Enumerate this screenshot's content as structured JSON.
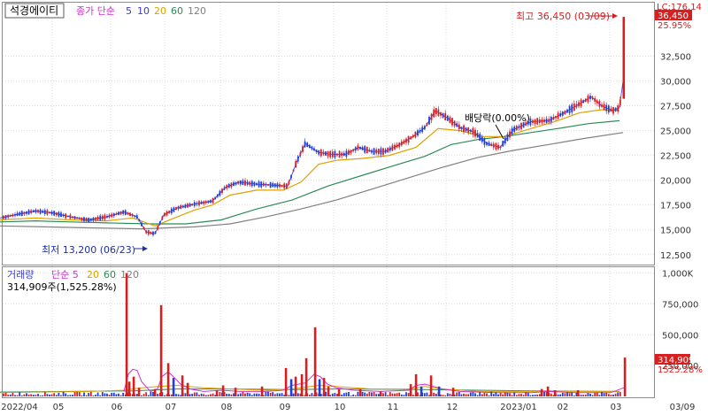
{
  "chart_data": [
    {
      "type": "candlestick",
      "title": "석경에이티",
      "legend": [
        {
          "label": "종가 단순",
          "color": "#cc33cc"
        },
        {
          "label": "5",
          "color": "#3a3ad8"
        },
        {
          "label": "10",
          "color": "#3a3ad8"
        },
        {
          "label": "20",
          "color": "#e0a000"
        },
        {
          "label": "60",
          "color": "#2e8b57"
        },
        {
          "label": "120",
          "color": "#808080"
        }
      ],
      "ylim": [
        11500,
        37800
      ],
      "yticks": [
        "12,500",
        "15,000",
        "17,500",
        "20,000",
        "22,500",
        "25,000",
        "27,500",
        "30,000",
        "32,500"
      ],
      "right_badges": {
        "lc": "LC:176.14",
        "last": "36,450",
        "pct": "25.95%"
      },
      "annotations": {
        "high": "최고 36,450 (03/09)",
        "low": "최저 13,200 (06/23)",
        "dividend": "배당락(0.00%)"
      },
      "series": [
        {
          "name": "5",
          "color": "#3a3ad8",
          "points": [
            [
              0,
              16200
            ],
            [
              22,
              16600
            ],
            [
              40,
              16900
            ],
            [
              60,
              16700
            ],
            [
              80,
              16300
            ],
            [
              100,
              16000
            ],
            [
              120,
              16300
            ],
            [
              140,
              16800
            ],
            [
              155,
              16300
            ],
            [
              165,
              14800
            ],
            [
              175,
              14600
            ],
            [
              185,
              16500
            ],
            [
              200,
              17200
            ],
            [
              220,
              17600
            ],
            [
              240,
              17900
            ],
            [
              255,
              19300
            ],
            [
              270,
              19800
            ],
            [
              290,
              19600
            ],
            [
              310,
              19500
            ],
            [
              325,
              19400
            ],
            [
              335,
              21800
            ],
            [
              345,
              23700
            ],
            [
              360,
              22800
            ],
            [
              375,
              22600
            ],
            [
              390,
              22600
            ],
            [
              405,
              23300
            ],
            [
              420,
              22900
            ],
            [
              435,
              22900
            ],
            [
              450,
              23500
            ],
            [
              465,
              24300
            ],
            [
              480,
              25300
            ],
            [
              492,
              27000
            ],
            [
              505,
              26300
            ],
            [
              520,
              25300
            ],
            [
              535,
              24900
            ],
            [
              550,
              23700
            ],
            [
              565,
              23300
            ],
            [
              580,
              25100
            ],
            [
              600,
              25900
            ],
            [
              620,
              26000
            ],
            [
              640,
              26900
            ],
            [
              655,
              27700
            ],
            [
              668,
              28400
            ],
            [
              680,
              27500
            ],
            [
              692,
              27000
            ],
            [
              700,
              27300
            ],
            [
              704,
              30000
            ]
          ]
        },
        {
          "name": "20",
          "color": "#e0a000",
          "points": [
            [
              0,
              16000
            ],
            [
              40,
              16200
            ],
            [
              80,
              16000
            ],
            [
              120,
              15900
            ],
            [
              150,
              16200
            ],
            [
              175,
              15400
            ],
            [
              200,
              16300
            ],
            [
              220,
              17000
            ],
            [
              240,
              17500
            ],
            [
              260,
              18500
            ],
            [
              290,
              19000
            ],
            [
              320,
              19000
            ],
            [
              340,
              19800
            ],
            [
              360,
              21600
            ],
            [
              380,
              22000
            ],
            [
              410,
              22200
            ],
            [
              440,
              22500
            ],
            [
              470,
              23300
            ],
            [
              495,
              25200
            ],
            [
              520,
              25000
            ],
            [
              545,
              24400
            ],
            [
              570,
              24400
            ],
            [
              600,
              25200
            ],
            [
              630,
              26000
            ],
            [
              655,
              26800
            ],
            [
              680,
              27100
            ],
            [
              700,
              27000
            ]
          ]
        },
        {
          "name": "60",
          "color": "#2e8b57",
          "points": [
            [
              0,
              15800
            ],
            [
              40,
              15900
            ],
            [
              80,
              15800
            ],
            [
              120,
              15700
            ],
            [
              170,
              15600
            ],
            [
              210,
              15600
            ],
            [
              250,
              16000
            ],
            [
              290,
              17100
            ],
            [
              330,
              18000
            ],
            [
              370,
              19400
            ],
            [
              410,
              20500
            ],
            [
              450,
              21600
            ],
            [
              480,
              22400
            ],
            [
              510,
              23600
            ],
            [
              540,
              24100
            ],
            [
              570,
              24400
            ],
            [
              600,
              24800
            ],
            [
              630,
              25200
            ],
            [
              665,
              25700
            ],
            [
              700,
              26000
            ]
          ]
        },
        {
          "name": "120",
          "color": "#808080",
          "points": [
            [
              0,
              15400
            ],
            [
              50,
              15300
            ],
            [
              100,
              15200
            ],
            [
              160,
              15100
            ],
            [
              220,
              15300
            ],
            [
              260,
              15600
            ],
            [
              300,
              16300
            ],
            [
              340,
              17100
            ],
            [
              380,
              18000
            ],
            [
              420,
              19100
            ],
            [
              460,
              20200
            ],
            [
              500,
              21300
            ],
            [
              540,
              22300
            ],
            [
              580,
              23000
            ],
            [
              620,
              23600
            ],
            [
              660,
              24200
            ],
            [
              704,
              24800
            ]
          ]
        }
      ]
    },
    {
      "type": "bar",
      "title": "거래량",
      "legend": [
        {
          "label": "거래량",
          "color": "#3a3ad8"
        },
        {
          "label": "단순 5",
          "color": "#cc33cc"
        },
        {
          "label": "20",
          "color": "#e0a000"
        },
        {
          "label": "60",
          "color": "#2e8b57"
        },
        {
          "label": "120",
          "color": "#808080"
        }
      ],
      "subtitle": "314,909주(1,525.28%)",
      "ylim": [
        0,
        1040000
      ],
      "yticks": [
        "1,000K",
        "750,000",
        "500,000",
        "250,000"
      ],
      "right_badges": {
        "last": "314,909",
        "pct": "1525.28%"
      },
      "spikes": [
        [
          143,
          1000000,
          "up"
        ],
        [
          146,
          120000,
          "up"
        ],
        [
          151,
          160000,
          "up"
        ],
        [
          157,
          70000,
          "up"
        ],
        [
          175,
          60000,
          "up"
        ],
        [
          182,
          740000,
          "up"
        ],
        [
          190,
          270000,
          "up"
        ],
        [
          196,
          150000,
          "down"
        ],
        [
          206,
          170000,
          "up"
        ],
        [
          212,
          110000,
          "up"
        ],
        [
          245,
          50000,
          "up"
        ],
        [
          252,
          90000,
          "up"
        ],
        [
          266,
          70000,
          "up"
        ],
        [
          296,
          80000,
          "up"
        ],
        [
          323,
          230000,
          "up"
        ],
        [
          329,
          140000,
          "down"
        ],
        [
          334,
          160000,
          "up"
        ],
        [
          341,
          180000,
          "up"
        ],
        [
          346,
          310000,
          "up"
        ],
        [
          356,
          560000,
          "up"
        ],
        [
          361,
          140000,
          "down"
        ],
        [
          366,
          150000,
          "up"
        ],
        [
          371,
          80000,
          "up"
        ],
        [
          383,
          60000,
          "up"
        ],
        [
          407,
          60000,
          "up"
        ],
        [
          430,
          40000,
          "up"
        ],
        [
          464,
          100000,
          "up"
        ],
        [
          470,
          180000,
          "up"
        ],
        [
          476,
          80000,
          "down"
        ],
        [
          487,
          170000,
          "up"
        ],
        [
          496,
          80000,
          "down"
        ],
        [
          512,
          70000,
          "up"
        ],
        [
          612,
          60000,
          "up"
        ],
        [
          619,
          80000,
          "up"
        ],
        [
          627,
          50000,
          "up"
        ],
        [
          653,
          50000,
          "up"
        ],
        [
          706,
          314909,
          "up"
        ]
      ],
      "avg5": [
        [
          140,
          40000
        ],
        [
          145,
          180000
        ],
        [
          150,
          220000
        ],
        [
          155,
          210000
        ],
        [
          160,
          120000
        ],
        [
          170,
          40000
        ],
        [
          178,
          60000
        ],
        [
          183,
          160000
        ],
        [
          190,
          200000
        ],
        [
          196,
          160000
        ],
        [
          204,
          100000
        ],
        [
          215,
          60000
        ],
        [
          230,
          40000
        ],
        [
          250,
          50000
        ],
        [
          270,
          40000
        ],
        [
          300,
          40000
        ],
        [
          320,
          50000
        ],
        [
          330,
          90000
        ],
        [
          345,
          110000
        ],
        [
          355,
          180000
        ],
        [
          362,
          160000
        ],
        [
          370,
          100000
        ],
        [
          380,
          70000
        ],
        [
          400,
          50000
        ],
        [
          430,
          40000
        ],
        [
          462,
          50000
        ],
        [
          470,
          90000
        ],
        [
          480,
          100000
        ],
        [
          490,
          80000
        ],
        [
          500,
          60000
        ],
        [
          520,
          40000
        ],
        [
          560,
          30000
        ],
        [
          600,
          30000
        ],
        [
          620,
          40000
        ],
        [
          650,
          30000
        ],
        [
          690,
          30000
        ],
        [
          705,
          70000
        ]
      ],
      "avg20": [
        [
          0,
          30000
        ],
        [
          100,
          40000
        ],
        [
          140,
          50000
        ],
        [
          160,
          70000
        ],
        [
          180,
          80000
        ],
        [
          200,
          90000
        ],
        [
          230,
          70000
        ],
        [
          260,
          60000
        ],
        [
          300,
          50000
        ],
        [
          330,
          60000
        ],
        [
          360,
          90000
        ],
        [
          380,
          80000
        ],
        [
          420,
          60000
        ],
        [
          460,
          60000
        ],
        [
          480,
          80000
        ],
        [
          500,
          60000
        ],
        [
          540,
          40000
        ],
        [
          600,
          40000
        ],
        [
          650,
          40000
        ],
        [
          700,
          40000
        ]
      ],
      "avg60": [
        [
          0,
          35000
        ],
        [
          150,
          45000
        ],
        [
          200,
          60000
        ],
        [
          260,
          60000
        ],
        [
          330,
          55000
        ],
        [
          380,
          60000
        ],
        [
          430,
          58000
        ],
        [
          480,
          55000
        ],
        [
          540,
          50000
        ],
        [
          600,
          45000
        ],
        [
          700,
          40000
        ]
      ]
    }
  ],
  "x_axis": {
    "labels": [
      {
        "label": "2022/04",
        "x": 22
      },
      {
        "label": "05",
        "x": 66
      },
      {
        "label": "06",
        "x": 132
      },
      {
        "label": "07",
        "x": 193
      },
      {
        "label": "08",
        "x": 256
      },
      {
        "label": "09",
        "x": 322
      },
      {
        "label": "10",
        "x": 384
      },
      {
        "label": "11",
        "x": 444
      },
      {
        "label": "12",
        "x": 511
      },
      {
        "label": "2023/01",
        "x": 586
      },
      {
        "label": "02",
        "x": 636
      },
      {
        "label": "03",
        "x": 696
      },
      {
        "label": "03/09",
        "x": 771
      }
    ]
  }
}
